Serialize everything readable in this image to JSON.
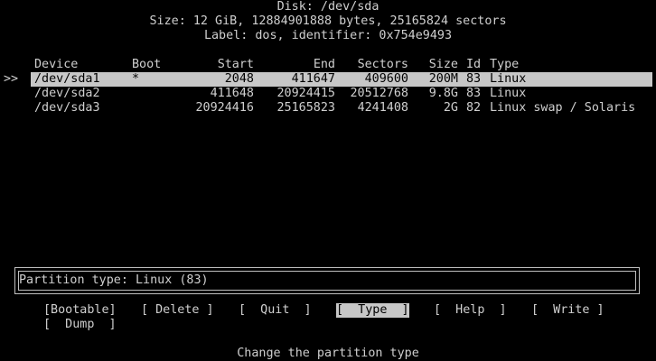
{
  "header": {
    "disk": "Disk: /dev/sda",
    "size": "Size: 12 GiB, 12884901888 bytes, 25165824 sectors",
    "label": "Label: dos, identifier: 0x754e9493"
  },
  "table": {
    "pointer": ">>",
    "columns": {
      "device": "Device",
      "boot": "Boot",
      "start": "Start",
      "end": "End",
      "sectors": "Sectors",
      "size": "Size",
      "id": "Id",
      "type": "Type"
    },
    "rows": [
      {
        "device": "/dev/sda1",
        "boot": "*",
        "start": "2048",
        "end": "411647",
        "sectors": "409600",
        "size": "200M",
        "id": "83",
        "type": "Linux"
      },
      {
        "device": "/dev/sda2",
        "boot": "",
        "start": "411648",
        "end": "20924415",
        "sectors": "20512768",
        "size": "9.8G",
        "id": "83",
        "type": "Linux"
      },
      {
        "device": "/dev/sda3",
        "boot": "",
        "start": "20924416",
        "end": "25165823",
        "sectors": "4241408",
        "size": "2G",
        "id": "82",
        "type": "Linux swap / Solaris"
      }
    ]
  },
  "info": {
    "partition_type": "Partition type: Linux (83)"
  },
  "menu": {
    "bootable": "[Bootable]",
    "delete": "[ Delete ]",
    "quit": "[  Quit  ]",
    "type": "[  Type  ]",
    "help": "[  Help  ]",
    "write": "[  Write ]",
    "dump": "[  Dump  ]"
  },
  "status": {
    "hint": "Change the partition type"
  },
  "colors": {
    "background": "#000000",
    "text": "#cfcfcf",
    "highlight": "#c7c7c7"
  }
}
